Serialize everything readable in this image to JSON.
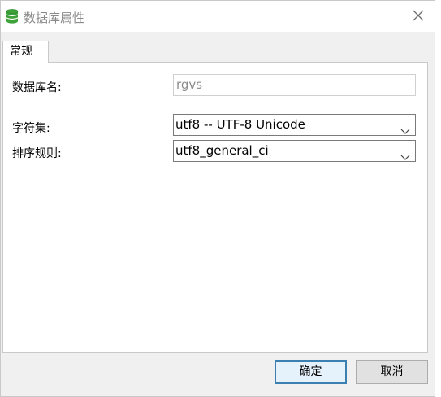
{
  "window": {
    "title": "数据库属性",
    "title_icon": "database-icon",
    "close_icon": "close-icon"
  },
  "tabs": [
    {
      "label": "常规"
    }
  ],
  "form": {
    "db_name": {
      "label": "数据库名:",
      "value": "rgvs"
    },
    "charset": {
      "label": "字符集:",
      "value": "utf8 -- UTF-8 Unicode"
    },
    "collation": {
      "label": "排序规则:",
      "value": "utf8_general_ci"
    }
  },
  "buttons": {
    "ok": "确定",
    "cancel": "取消"
  },
  "colors": {
    "icon_green": "#3ea23a",
    "primary_border": "#3c7fb1"
  }
}
